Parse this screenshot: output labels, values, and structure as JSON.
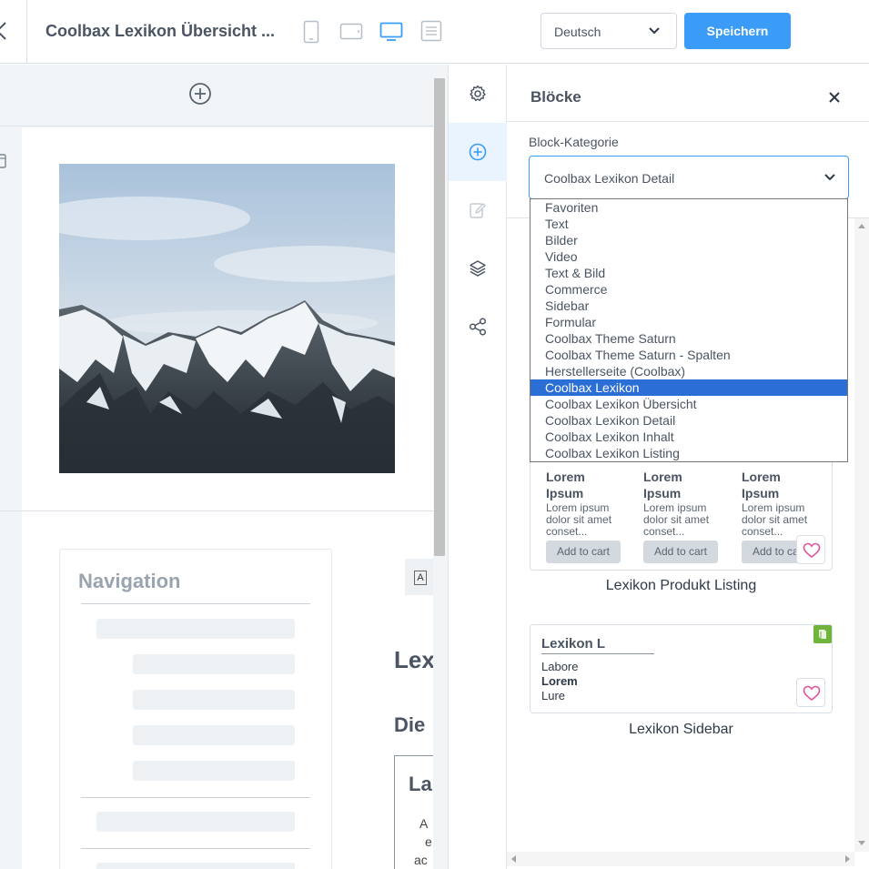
{
  "header": {
    "title": "Coolbax Lexikon Übersicht ...",
    "language": "Deutsch",
    "save_label": "Speichern"
  },
  "canvas": {
    "nav_title": "Navigation",
    "cut_glyph": "A",
    "heading_1": "Lex",
    "heading_2": "Die",
    "box_heading": "La",
    "box_lines": [
      "A",
      "e",
      "ac"
    ]
  },
  "panel": {
    "title": "Blöcke",
    "category_label": "Block-Kategorie",
    "category_value": "Coolbax Lexikon Detail",
    "dropdown_options": [
      "Favoriten",
      "Text",
      "Bilder",
      "Video",
      "Text & Bild",
      "Commerce",
      "Sidebar",
      "Formular",
      "Coolbax Theme Saturn",
      "Coolbax Theme Saturn - Spalten",
      "Herstellerseite (Coolbax)",
      "Coolbax Lexikon",
      "Coolbax Lexikon Übersicht",
      "Coolbax Lexikon Detail",
      "Coolbax Lexikon Inhalt",
      "Coolbax Lexikon Listing"
    ],
    "highlighted_option": "Coolbax Lexikon",
    "listing_block": {
      "products": [
        {
          "name_1": "Lorem",
          "name_2": "Ipsum",
          "desc": [
            "Lorem ipsum",
            "dolor sit amet",
            "conset..."
          ],
          "cart": "Add to cart"
        },
        {
          "name_1": "Lorem",
          "name_2": "Ipsum",
          "desc": [
            "Lorem ipsum",
            "dolor sit amet",
            "conset..."
          ],
          "cart": "Add to cart"
        },
        {
          "name_1": "Lorem",
          "name_2": "Ipsum",
          "desc": [
            "Lorem ipsum",
            "dolor sit amet",
            "conset..."
          ],
          "cart": "Add to cart"
        }
      ],
      "label": "Lexikon Produkt Listing"
    },
    "sidebar_block": {
      "title": "Lexikon L",
      "items": [
        "Labore",
        "Lorem",
        "Lure"
      ],
      "label": "Lexikon Sidebar"
    }
  },
  "colors": {
    "accent": "#3a9cf7",
    "selected_option": "#2b6fd6",
    "heart": "#e0529c",
    "badge": "#6fb53b"
  }
}
